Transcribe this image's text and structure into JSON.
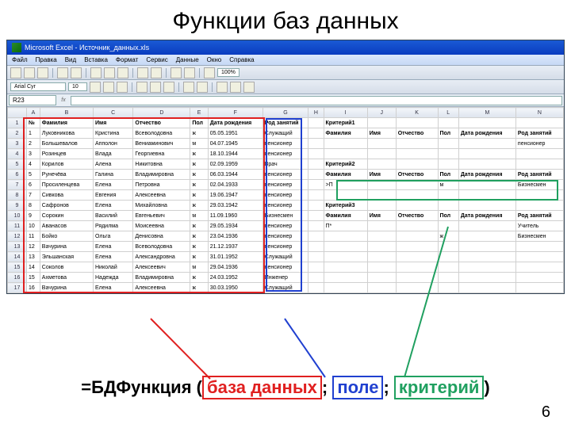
{
  "slide_title": "Функции баз данных",
  "window_title": "Microsoft Excel - Источник_данных.xls",
  "menu": [
    "Файл",
    "Правка",
    "Вид",
    "Вставка",
    "Формат",
    "Сервис",
    "Данные",
    "Окно",
    "Справка"
  ],
  "font_name": "Arial Cyr",
  "font_size": "10",
  "zoom": "100%",
  "namebox": "R23",
  "cols": [
    "A",
    "B",
    "C",
    "D",
    "E",
    "F",
    "G",
    "H",
    "I",
    "J",
    "K",
    "L",
    "M",
    "N"
  ],
  "headers": {
    "a": "№",
    "b": "Фамилия",
    "c": "Имя",
    "d": "Отчество",
    "e": "Пол",
    "f": "Дата рождения",
    "g": "Род занятий"
  },
  "rows": [
    {
      "n": "1",
      "f": "Луковникова",
      "i": "Кристина",
      "o": "Всеволодовна",
      "p": "ж",
      "d": "05.05.1951",
      "r": "Служащий"
    },
    {
      "n": "2",
      "f": "Большевалов",
      "i": "Апполон",
      "o": "Вениаминович",
      "p": "м",
      "d": "04.07.1945",
      "r": "пенсионер"
    },
    {
      "n": "3",
      "f": "Розинцев",
      "i": "Влада",
      "o": "Георгиевна",
      "p": "ж",
      "d": "18.10.1944",
      "r": "пенсионер"
    },
    {
      "n": "4",
      "f": "Корилов",
      "i": "Алена",
      "o": "Никитовна",
      "p": "ж",
      "d": "02.09.1959",
      "r": "Врач"
    },
    {
      "n": "5",
      "f": "Рунечёва",
      "i": "Галина",
      "o": "Владимировна",
      "p": "ж",
      "d": "06.03.1944",
      "r": "пенсионер"
    },
    {
      "n": "6",
      "f": "Просиленцева",
      "i": "Елена",
      "o": "Петровна",
      "p": "ж",
      "d": "02.04.1933",
      "r": "пенсионер"
    },
    {
      "n": "7",
      "f": "Сивкова",
      "i": "Евгения",
      "o": "Алексеевна",
      "p": "ж",
      "d": "19.06.1947",
      "r": "пенсионер"
    },
    {
      "n": "8",
      "f": "Сафронов",
      "i": "Елена",
      "o": "Михайловна",
      "p": "ж",
      "d": "29.03.1942",
      "r": "пенсионер"
    },
    {
      "n": "9",
      "f": "Сорокин",
      "i": "Василий",
      "o": "Евгеньевич",
      "p": "м",
      "d": "11.09.1960",
      "r": "Бизнесмен"
    },
    {
      "n": "10",
      "f": "Аванасов",
      "i": "Рядилма",
      "o": "Моисеевна",
      "p": "ж",
      "d": "29.05.1934",
      "r": "пенсионер"
    },
    {
      "n": "11",
      "f": "Бойко",
      "i": "Ольга",
      "o": "Денисовна",
      "p": "ж",
      "d": "23.04.1936",
      "r": "пенсионер"
    },
    {
      "n": "12",
      "f": "Вачурина",
      "i": "Елена",
      "o": "Всеволодовна",
      "p": "ж",
      "d": "21.12.1937",
      "r": "пенсионер"
    },
    {
      "n": "13",
      "f": "Эльшанская",
      "i": "Елена",
      "o": "Александровна",
      "p": "ж",
      "d": "31.01.1952",
      "r": "Служащий"
    },
    {
      "n": "14",
      "f": "Соколов",
      "i": "Николай",
      "o": "Алексеевич",
      "p": "м",
      "d": "29.04.1936",
      "r": "пенсионер"
    },
    {
      "n": "15",
      "f": "Ахметова",
      "i": "Надежда",
      "o": "Владимировна",
      "p": "ж",
      "d": "24.03.1952",
      "r": "Инженер"
    },
    {
      "n": "16",
      "f": "Вачурина",
      "i": "Елена",
      "o": "Алексеевна",
      "p": "ж",
      "d": "30.03.1950",
      "r": "Служащий"
    }
  ],
  "criteria1": {
    "title": "Критерий1",
    "h": [
      "Фамилия",
      "Имя",
      "Отчество",
      "Пол",
      "Дата рождения",
      "Род занятий"
    ],
    "r": [
      "",
      "",
      "",
      "",
      "",
      "пенсионер"
    ]
  },
  "criteria2": {
    "title": "Критерий2",
    "h": [
      "Фамилия",
      "Имя",
      "Отчество",
      "Пол",
      "Дата рождения",
      "Род занятий"
    ],
    "r": [
      ">П",
      "",
      "",
      "м",
      "",
      "Бизнесмен"
    ]
  },
  "criteria3": {
    "title": "Критерий3",
    "h": [
      "Фамилия",
      "Имя",
      "Отчество",
      "Пол",
      "Дата рождения",
      "Род занятий"
    ],
    "r1": [
      "П*",
      "",
      "",
      "",
      "",
      "Учитель"
    ],
    "r2": [
      "",
      "",
      "",
      "ж",
      "",
      "Бизнесмен"
    ]
  },
  "formula": {
    "prefix": "=БДФункция (",
    "db": "база данных",
    "sep1": "; ",
    "fld": "поле",
    "sep2": "; ",
    "cri": "критерий",
    "suffix": ")"
  },
  "page": "6"
}
